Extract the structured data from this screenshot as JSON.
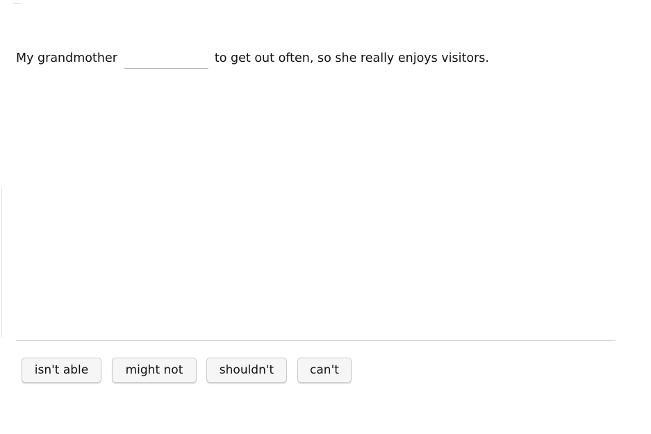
{
  "question": {
    "before_blank": "My grandmother",
    "after_blank": "to get out often, so she really enjoys visitors.",
    "blank_value": ""
  },
  "choices": [
    {
      "label": "isn't able"
    },
    {
      "label": "might not"
    },
    {
      "label": "shouldn't"
    },
    {
      "label": "can't"
    }
  ]
}
